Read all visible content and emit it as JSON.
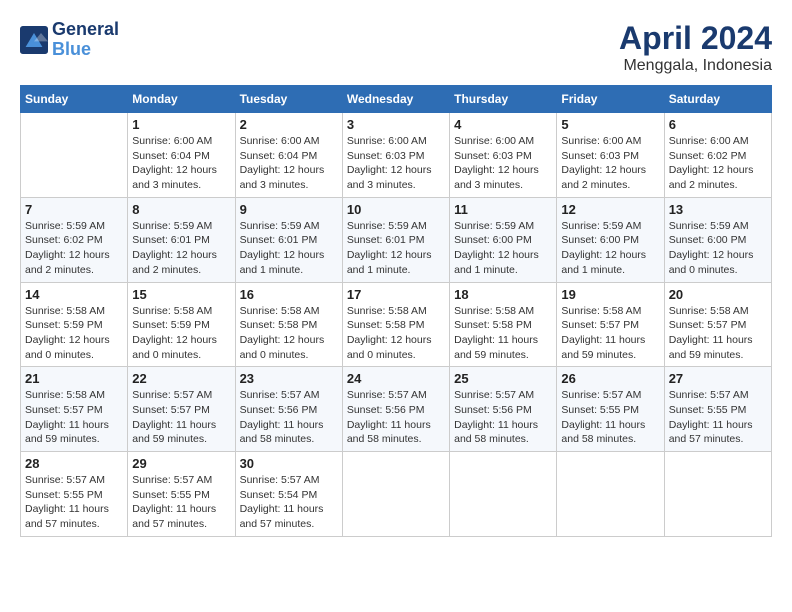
{
  "header": {
    "logo_line1": "General",
    "logo_line2": "Blue",
    "main_title": "April 2024",
    "subtitle": "Menggala, Indonesia"
  },
  "days_of_week": [
    "Sunday",
    "Monday",
    "Tuesday",
    "Wednesday",
    "Thursday",
    "Friday",
    "Saturday"
  ],
  "weeks": [
    [
      {
        "day": "",
        "info": ""
      },
      {
        "day": "1",
        "info": "Sunrise: 6:00 AM\nSunset: 6:04 PM\nDaylight: 12 hours\nand 3 minutes."
      },
      {
        "day": "2",
        "info": "Sunrise: 6:00 AM\nSunset: 6:04 PM\nDaylight: 12 hours\nand 3 minutes."
      },
      {
        "day": "3",
        "info": "Sunrise: 6:00 AM\nSunset: 6:03 PM\nDaylight: 12 hours\nand 3 minutes."
      },
      {
        "day": "4",
        "info": "Sunrise: 6:00 AM\nSunset: 6:03 PM\nDaylight: 12 hours\nand 3 minutes."
      },
      {
        "day": "5",
        "info": "Sunrise: 6:00 AM\nSunset: 6:03 PM\nDaylight: 12 hours\nand 2 minutes."
      },
      {
        "day": "6",
        "info": "Sunrise: 6:00 AM\nSunset: 6:02 PM\nDaylight: 12 hours\nand 2 minutes."
      }
    ],
    [
      {
        "day": "7",
        "info": "Sunrise: 5:59 AM\nSunset: 6:02 PM\nDaylight: 12 hours\nand 2 minutes."
      },
      {
        "day": "8",
        "info": "Sunrise: 5:59 AM\nSunset: 6:01 PM\nDaylight: 12 hours\nand 2 minutes."
      },
      {
        "day": "9",
        "info": "Sunrise: 5:59 AM\nSunset: 6:01 PM\nDaylight: 12 hours\nand 1 minute."
      },
      {
        "day": "10",
        "info": "Sunrise: 5:59 AM\nSunset: 6:01 PM\nDaylight: 12 hours\nand 1 minute."
      },
      {
        "day": "11",
        "info": "Sunrise: 5:59 AM\nSunset: 6:00 PM\nDaylight: 12 hours\nand 1 minute."
      },
      {
        "day": "12",
        "info": "Sunrise: 5:59 AM\nSunset: 6:00 PM\nDaylight: 12 hours\nand 1 minute."
      },
      {
        "day": "13",
        "info": "Sunrise: 5:59 AM\nSunset: 6:00 PM\nDaylight: 12 hours\nand 0 minutes."
      }
    ],
    [
      {
        "day": "14",
        "info": "Sunrise: 5:58 AM\nSunset: 5:59 PM\nDaylight: 12 hours\nand 0 minutes."
      },
      {
        "day": "15",
        "info": "Sunrise: 5:58 AM\nSunset: 5:59 PM\nDaylight: 12 hours\nand 0 minutes."
      },
      {
        "day": "16",
        "info": "Sunrise: 5:58 AM\nSunset: 5:58 PM\nDaylight: 12 hours\nand 0 minutes."
      },
      {
        "day": "17",
        "info": "Sunrise: 5:58 AM\nSunset: 5:58 PM\nDaylight: 12 hours\nand 0 minutes."
      },
      {
        "day": "18",
        "info": "Sunrise: 5:58 AM\nSunset: 5:58 PM\nDaylight: 11 hours\nand 59 minutes."
      },
      {
        "day": "19",
        "info": "Sunrise: 5:58 AM\nSunset: 5:57 PM\nDaylight: 11 hours\nand 59 minutes."
      },
      {
        "day": "20",
        "info": "Sunrise: 5:58 AM\nSunset: 5:57 PM\nDaylight: 11 hours\nand 59 minutes."
      }
    ],
    [
      {
        "day": "21",
        "info": "Sunrise: 5:58 AM\nSunset: 5:57 PM\nDaylight: 11 hours\nand 59 minutes."
      },
      {
        "day": "22",
        "info": "Sunrise: 5:57 AM\nSunset: 5:57 PM\nDaylight: 11 hours\nand 59 minutes."
      },
      {
        "day": "23",
        "info": "Sunrise: 5:57 AM\nSunset: 5:56 PM\nDaylight: 11 hours\nand 58 minutes."
      },
      {
        "day": "24",
        "info": "Sunrise: 5:57 AM\nSunset: 5:56 PM\nDaylight: 11 hours\nand 58 minutes."
      },
      {
        "day": "25",
        "info": "Sunrise: 5:57 AM\nSunset: 5:56 PM\nDaylight: 11 hours\nand 58 minutes."
      },
      {
        "day": "26",
        "info": "Sunrise: 5:57 AM\nSunset: 5:55 PM\nDaylight: 11 hours\nand 58 minutes."
      },
      {
        "day": "27",
        "info": "Sunrise: 5:57 AM\nSunset: 5:55 PM\nDaylight: 11 hours\nand 57 minutes."
      }
    ],
    [
      {
        "day": "28",
        "info": "Sunrise: 5:57 AM\nSunset: 5:55 PM\nDaylight: 11 hours\nand 57 minutes."
      },
      {
        "day": "29",
        "info": "Sunrise: 5:57 AM\nSunset: 5:55 PM\nDaylight: 11 hours\nand 57 minutes."
      },
      {
        "day": "30",
        "info": "Sunrise: 5:57 AM\nSunset: 5:54 PM\nDaylight: 11 hours\nand 57 minutes."
      },
      {
        "day": "",
        "info": ""
      },
      {
        "day": "",
        "info": ""
      },
      {
        "day": "",
        "info": ""
      },
      {
        "day": "",
        "info": ""
      }
    ]
  ]
}
